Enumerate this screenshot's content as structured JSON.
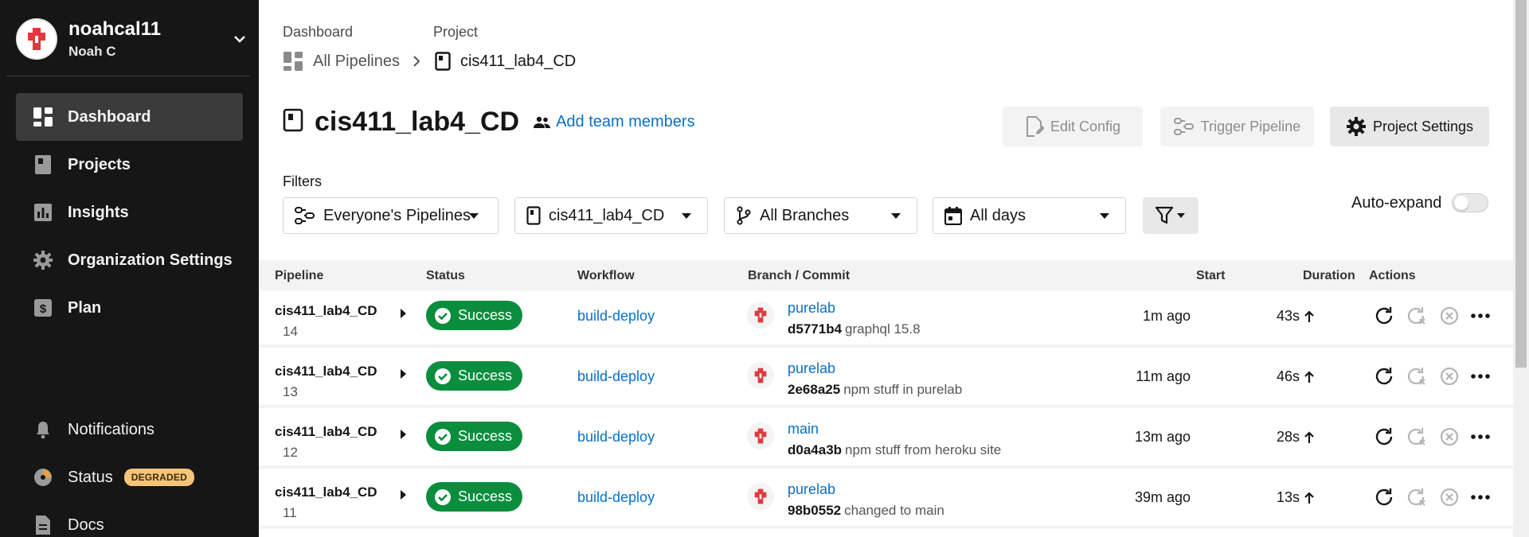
{
  "user": {
    "username": "noahcal11",
    "fullname": "Noah C"
  },
  "sidebar": {
    "items": [
      {
        "label": "Dashboard",
        "icon": "dashboard-icon"
      },
      {
        "label": "Projects",
        "icon": "projects-icon"
      },
      {
        "label": "Insights",
        "icon": "insights-icon"
      },
      {
        "label": "Organization Settings",
        "icon": "gear-icon"
      },
      {
        "label": "Plan",
        "icon": "plan-icon"
      }
    ],
    "bottom": [
      {
        "label": "Notifications",
        "icon": "bell-icon"
      },
      {
        "label": "Status",
        "icon": "status-icon",
        "badge": "DEGRADED"
      },
      {
        "label": "Docs",
        "icon": "docs-icon"
      }
    ]
  },
  "breadcrumb": {
    "dashboard_label": "Dashboard",
    "project_label": "Project",
    "all_pipelines": "All Pipelines",
    "project_name": "cis411_lab4_CD"
  },
  "header": {
    "title": "cis411_lab4_CD",
    "add_team": "Add team members",
    "edit_config": "Edit Config",
    "trigger_pipeline": "Trigger Pipeline",
    "project_settings": "Project Settings"
  },
  "filters": {
    "label": "Filters",
    "pipelines": "Everyone's Pipelines",
    "project": "cis411_lab4_CD",
    "branches": "All Branches",
    "days": "All days",
    "auto_expand": "Auto-expand"
  },
  "table": {
    "headers": {
      "pipeline": "Pipeline",
      "status": "Status",
      "workflow": "Workflow",
      "branch_commit": "Branch / Commit",
      "start": "Start",
      "duration": "Duration",
      "actions": "Actions"
    },
    "rows": [
      {
        "name": "cis411_lab4_CD",
        "number": "14",
        "status": "Success",
        "workflow": "build-deploy",
        "branch": "purelab",
        "sha": "d5771b4",
        "message": "graphql 15.8",
        "start": "1m ago",
        "duration": "43s"
      },
      {
        "name": "cis411_lab4_CD",
        "number": "13",
        "status": "Success",
        "workflow": "build-deploy",
        "branch": "purelab",
        "sha": "2e68a25",
        "message": "npm stuff in purelab",
        "start": "11m ago",
        "duration": "46s"
      },
      {
        "name": "cis411_lab4_CD",
        "number": "12",
        "status": "Success",
        "workflow": "build-deploy",
        "branch": "main",
        "sha": "d0a4a3b",
        "message": "npm stuff from heroku site",
        "start": "13m ago",
        "duration": "28s"
      },
      {
        "name": "cis411_lab4_CD",
        "number": "11",
        "status": "Success",
        "workflow": "build-deploy",
        "branch": "purelab",
        "sha": "98b0552",
        "message": "changed to main",
        "start": "39m ago",
        "duration": "13s"
      }
    ]
  },
  "colors": {
    "sidebar": "#161616",
    "success": "#0a8d3d",
    "link": "#0b6fc7",
    "badge": "#f5c47a"
  }
}
